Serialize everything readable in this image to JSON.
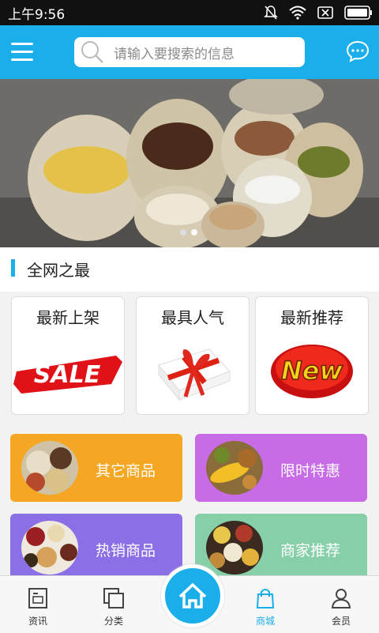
{
  "status": {
    "time": "上午9:56"
  },
  "search": {
    "placeholder": "请输入要搜索的信息"
  },
  "section": {
    "title": "全网之最"
  },
  "cards": [
    {
      "label": "最新上架",
      "badge": "SALE"
    },
    {
      "label": "最具人气"
    },
    {
      "label": "最新推荐",
      "badge": "New"
    }
  ],
  "categories": [
    {
      "label": "其它商品",
      "color": "#f5a623"
    },
    {
      "label": "限时特惠",
      "color": "#c76be6"
    },
    {
      "label": "热销商品",
      "color": "#8b6fe6"
    },
    {
      "label": "商家推荐",
      "color": "#86cfa8"
    }
  ],
  "nav": [
    {
      "label": "资讯"
    },
    {
      "label": "分类"
    },
    {
      "label": "商城"
    },
    {
      "label": "会员"
    }
  ],
  "colors": {
    "accent": "#1aaeea",
    "active": "#1aaeea"
  }
}
